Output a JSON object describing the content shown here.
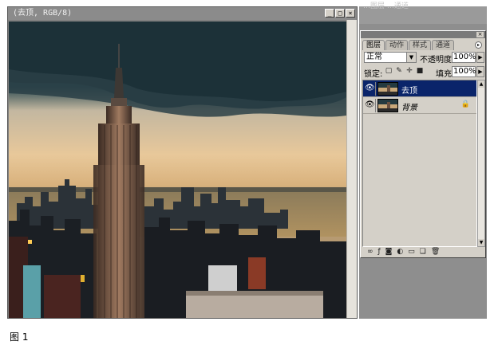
{
  "document": {
    "title": "(去顶, RGB/8)",
    "win_buttons": [
      "_",
      "□",
      "×"
    ]
  },
  "behind": {
    "strip_text": "…图层 …通道"
  },
  "palette": {
    "tabs": [
      "图层",
      "动作",
      "样式",
      "通道"
    ],
    "blend_mode": "正常",
    "opacity_label": "不透明度:",
    "opacity_value": "100%",
    "lock_label": "锁定:",
    "fill_label": "填充:",
    "fill_value": "100%",
    "layers": [
      {
        "name": "去顶",
        "selected": true
      },
      {
        "name": "背景",
        "selected": false,
        "locked": true
      }
    ]
  },
  "icons": {
    "eye": "eye-icon",
    "lock": "lock-icon",
    "link": "link-icon",
    "layer_style": "fx-icon",
    "mask": "mask-icon",
    "adjustment": "adjustment-icon",
    "folder": "folder-icon",
    "new_layer": "new-layer-icon",
    "trash": "trash-icon"
  },
  "caption": "图 1"
}
